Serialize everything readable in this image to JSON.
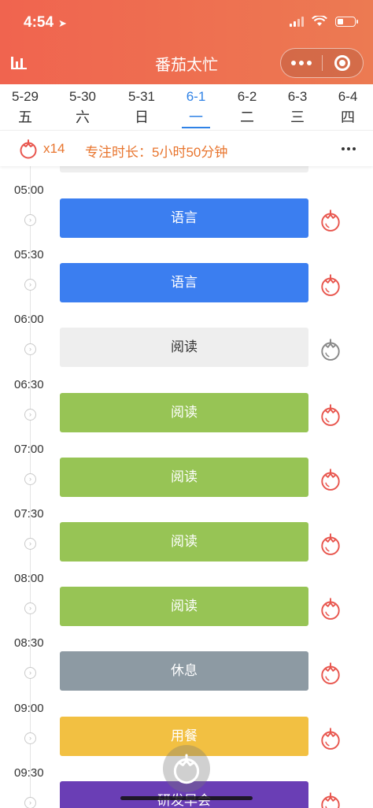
{
  "status_bar": {
    "time": "4:54"
  },
  "nav": {
    "title": "番茄太忙"
  },
  "days": [
    {
      "date": "5-29",
      "weekday": "五",
      "active": false
    },
    {
      "date": "5-30",
      "weekday": "六",
      "active": false
    },
    {
      "date": "5-31",
      "weekday": "日",
      "active": false
    },
    {
      "date": "6-1",
      "weekday": "一",
      "active": true
    },
    {
      "date": "6-2",
      "weekday": "二",
      "active": false
    },
    {
      "date": "6-3",
      "weekday": "三",
      "active": false
    },
    {
      "date": "6-4",
      "weekday": "四",
      "active": false
    }
  ],
  "summary": {
    "tomato_count": "x14",
    "focus_text": "专注时长：5小时50分钟"
  },
  "slots": [
    {
      "time": "05:00",
      "label": "语言",
      "color": "#3b7ef0",
      "tomato_color": "#e8554d"
    },
    {
      "time": "05:30",
      "label": "语言",
      "color": "#3b7ef0",
      "tomato_color": "#e8554d"
    },
    {
      "time": "06:00",
      "label": "阅读",
      "color": "#eeeeee",
      "tomato_color": "#888888"
    },
    {
      "time": "06:30",
      "label": "阅读",
      "color": "#97c455",
      "tomato_color": "#e8554d"
    },
    {
      "time": "07:00",
      "label": "阅读",
      "color": "#97c455",
      "tomato_color": "#e8554d"
    },
    {
      "time": "07:30",
      "label": "阅读",
      "color": "#97c455",
      "tomato_color": "#e8554d"
    },
    {
      "time": "08:00",
      "label": "阅读",
      "color": "#97c455",
      "tomato_color": "#e8554d"
    },
    {
      "time": "08:30",
      "label": "休息",
      "color": "#8d9aa3",
      "tomato_color": "#e8554d"
    },
    {
      "time": "09:00",
      "label": "用餐",
      "color": "#f2c042",
      "tomato_color": "#e8554d"
    },
    {
      "time": "09:30",
      "label": "研发早会",
      "color": "#6a3eb5",
      "tomato_color": "#e8554d"
    }
  ],
  "colors": {
    "header_start": "#f0644f",
    "header_end": "#ec7a52",
    "accent_blue": "#2f82e6",
    "accent_orange": "#e8752e"
  },
  "icons": {
    "nav_left": "bar-chart-icon",
    "capsule_more": "more-dots-icon",
    "capsule_close": "target-circle-icon",
    "summary": "tomato-icon",
    "slot_toggle": "chevron-right-icon",
    "slot_tomato": "tomato-icon",
    "fab": "tomato-icon"
  }
}
